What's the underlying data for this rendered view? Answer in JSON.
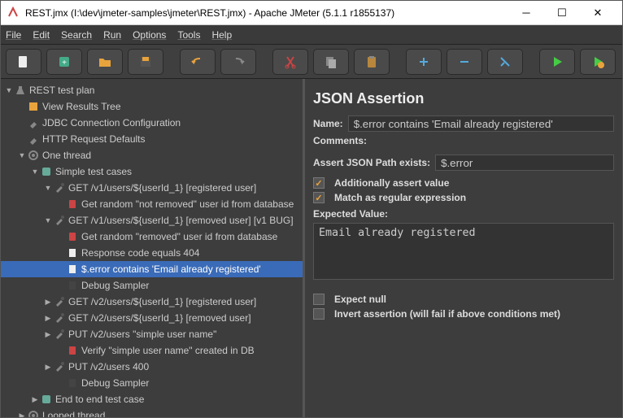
{
  "window": {
    "title": "REST.jmx (I:\\dev\\jmeter-samples\\jmeter\\REST.jmx) - Apache JMeter (5.1.1 r1855137)"
  },
  "menu": [
    "File",
    "Edit",
    "Search",
    "Run",
    "Options",
    "Tools",
    "Help"
  ],
  "tree": [
    {
      "d": 0,
      "exp": "open",
      "icon": "flask",
      "label": "REST test plan"
    },
    {
      "d": 1,
      "exp": "",
      "icon": "yellow",
      "label": "View Results Tree"
    },
    {
      "d": 1,
      "exp": "",
      "icon": "wrench",
      "label": "JDBC Connection Configuration"
    },
    {
      "d": 1,
      "exp": "",
      "icon": "wrench",
      "label": "HTTP Request Defaults"
    },
    {
      "d": 1,
      "exp": "open",
      "icon": "gear",
      "label": "One thread"
    },
    {
      "d": 2,
      "exp": "open",
      "icon": "puzzle",
      "label": "Simple test cases"
    },
    {
      "d": 3,
      "exp": "open",
      "icon": "dropper",
      "label": "GET /v1/users/${userId_1} [registered user]"
    },
    {
      "d": 4,
      "exp": "",
      "icon": "db",
      "label": "Get random \"not removed\" user id from database"
    },
    {
      "d": 3,
      "exp": "open",
      "icon": "dropper",
      "label": "GET /v1/users/${userId_1} [removed user] [v1 BUG]"
    },
    {
      "d": 4,
      "exp": "",
      "icon": "db",
      "label": "Get random \"removed\" user id from database"
    },
    {
      "d": 4,
      "exp": "",
      "icon": "page",
      "label": "Response code equals 404"
    },
    {
      "d": 4,
      "exp": "",
      "icon": "page",
      "label": "$.error contains 'Email already registered'",
      "sel": true
    },
    {
      "d": 4,
      "exp": "",
      "icon": "dark",
      "label": "Debug Sampler"
    },
    {
      "d": 3,
      "exp": "closed",
      "icon": "dropper",
      "label": "GET /v2/users/${userId_1} [registered user]"
    },
    {
      "d": 3,
      "exp": "closed",
      "icon": "dropper",
      "label": "GET /v2/users/${userId_1} [removed user]"
    },
    {
      "d": 3,
      "exp": "closed",
      "icon": "dropper",
      "label": "PUT /v2/users \"simple user name\""
    },
    {
      "d": 4,
      "exp": "",
      "icon": "db",
      "label": "Verify \"simple user name\" created in DB"
    },
    {
      "d": 3,
      "exp": "closed",
      "icon": "dropper",
      "label": "PUT /v2/users 400"
    },
    {
      "d": 4,
      "exp": "",
      "icon": "dark",
      "label": "Debug Sampler"
    },
    {
      "d": 2,
      "exp": "closed",
      "icon": "puzzle",
      "label": "End to end test case"
    },
    {
      "d": 1,
      "exp": "closed",
      "icon": "gear",
      "label": "Looped thread"
    }
  ],
  "panel": {
    "heading": "JSON Assertion",
    "name_lbl": "Name:",
    "name_val": "$.error contains 'Email already registered'",
    "comments_lbl": "Comments:",
    "path_lbl": "Assert JSON Path exists:",
    "path_val": "$.error",
    "cb_assert_value": "Additionally assert value",
    "cb_regex": "Match as regular expression",
    "expected_lbl": "Expected Value:",
    "expected_val": "Email already registered",
    "cb_expect_null": "Expect null",
    "cb_invert": "Invert assertion (will fail if above conditions met)"
  }
}
